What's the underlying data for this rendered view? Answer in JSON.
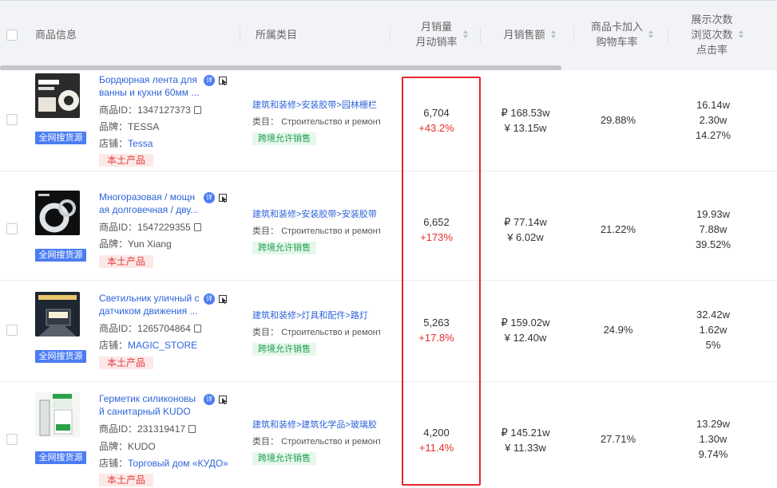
{
  "header": {
    "col_product": "商品信息",
    "col_category": "所属类目",
    "col_monthly_sales": "月销量",
    "col_monthly_rate": "月动销率",
    "col_revenue": "月销售额",
    "col_cart_rate_1": "商品卡加入",
    "col_cart_rate_2": "购物车率",
    "col_views_1": "展示次数",
    "col_views_2": "浏览次数",
    "col_views_3": "点击率"
  },
  "labels": {
    "source_button": "全网搜货源",
    "product_id": "商品ID：",
    "brand": "品牌：",
    "shop": "店铺：",
    "local_tag": "本土产品",
    "category_type": "类目：",
    "cross_border_tag": "跨境允许销售",
    "detail_badge": "详"
  },
  "colors": {
    "accent_blue": "#2f64d9",
    "highlight_red": "#e8262c",
    "growth_red": "#e62e2e",
    "allow_green": "#21a051"
  },
  "rows": [
    {
      "title_line1": "Бордюрная лента для",
      "title_line2": "ванны и кухни 60мм ...",
      "product_id": "1347127373",
      "brand": "TESSA",
      "shop": "Tessa",
      "category_path": "建筑和装修>安装胶带>园林栅栏",
      "category_type": "Строительство и ремонт",
      "monthly_sales": "6,704",
      "sales_growth": "+43.2%",
      "revenue_rub": "₽ 168.53w",
      "revenue_cny": "¥ 13.15w",
      "cart_rate": "29.88%",
      "impressions": "16.14w",
      "views": "2.30w",
      "ctr": "14.27%"
    },
    {
      "title_line1": "Многоразовая / мощн",
      "title_line2": "ая долговечная / дву...",
      "product_id": "1547229355",
      "brand": "Yun Xiang",
      "shop": "",
      "category_path": "建筑和装修>安装胶带>安装胶带",
      "category_type": "Строительство и ремонт",
      "monthly_sales": "6,652",
      "sales_growth": "+173%",
      "revenue_rub": "₽ 77.14w",
      "revenue_cny": "¥ 6.02w",
      "cart_rate": "21.22%",
      "impressions": "19.93w",
      "views": "7.88w",
      "ctr": "39.52%"
    },
    {
      "title_line1": "Светильник уличный с",
      "title_line2": "датчиком движения ...",
      "product_id": "1265704864",
      "brand": "",
      "shop": "MAGIC_STORE",
      "category_path": "建筑和装修>灯具和配件>路灯",
      "category_type": "Строительство и ремонт",
      "monthly_sales": "5,263",
      "sales_growth": "+17.8%",
      "revenue_rub": "₽ 159.02w",
      "revenue_cny": "¥ 12.40w",
      "cart_rate": "24.9%",
      "impressions": "32.42w",
      "views": "1.62w",
      "ctr": "5%"
    },
    {
      "title_line1": "Герметик силиконовы",
      "title_line2": "й санитарный KUDO ...",
      "product_id": "231319417",
      "brand": "KUDO",
      "shop": "Торговый дом «КУДО»",
      "category_path": "建筑和装修>建筑化学品>玻璃胶",
      "category_type": "Строительство и ремонт",
      "monthly_sales": "4,200",
      "sales_growth": "+11.4%",
      "revenue_rub": "₽ 145.21w",
      "revenue_cny": "¥ 11.33w",
      "cart_rate": "27.71%",
      "impressions": "13.29w",
      "views": "1.30w",
      "ctr": "9.74%"
    }
  ]
}
